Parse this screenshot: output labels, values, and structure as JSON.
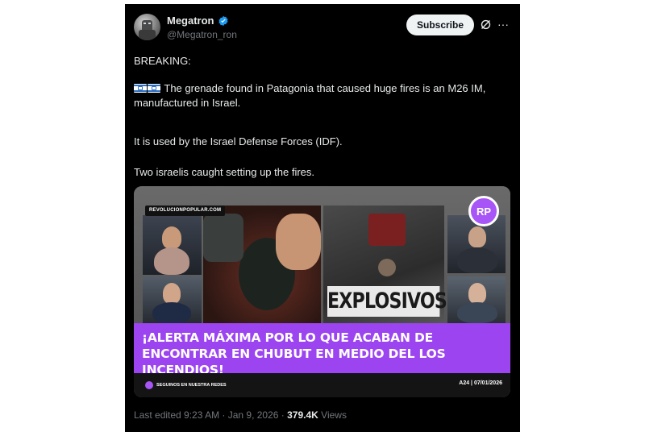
{
  "author": {
    "name": "Megatron",
    "handle": "@Megatron_ron"
  },
  "actions": {
    "subscribe_label": "Subscribe",
    "grok_icon": "grok-icon",
    "more_icon": "more-icon"
  },
  "post": {
    "line1": "BREAKING:",
    "line2": "The grenade found in Patagonia that caused huge fires is an M26 IM, manufactured in Israel.",
    "line3": "It is used by the Israel Defense Forces (IDF).",
    "line4": "Two israelis caught setting up the fires.",
    "flags": [
      "israel-flag-icon",
      "israel-flag-icon"
    ]
  },
  "media": {
    "site_tag": "REVOLUCIONPOPULAR.COM",
    "explosivos": "EXPLOSIVOS",
    "logo_text": "RP",
    "headline": "¡ALERTA MÁXIMA POR LO QUE ACABAN DE ENCONTRAR EN CHUBUT EN MEDIO DEL LOS INCENDIOS!",
    "follow_text": "SEGUINOS EN NUESTRA REDES",
    "date_text": "A24 | 07/01/2026",
    "accent_color": "#9b44f0"
  },
  "meta": {
    "edited": "Last edited 9:23 AM · Jan 9, 2026 · ",
    "views_count": "379.4K",
    "views_label": " Views"
  },
  "colors": {
    "background": "#000000",
    "text": "#e7e9ea",
    "muted": "#71767b",
    "verified": "#1d9bf0"
  }
}
